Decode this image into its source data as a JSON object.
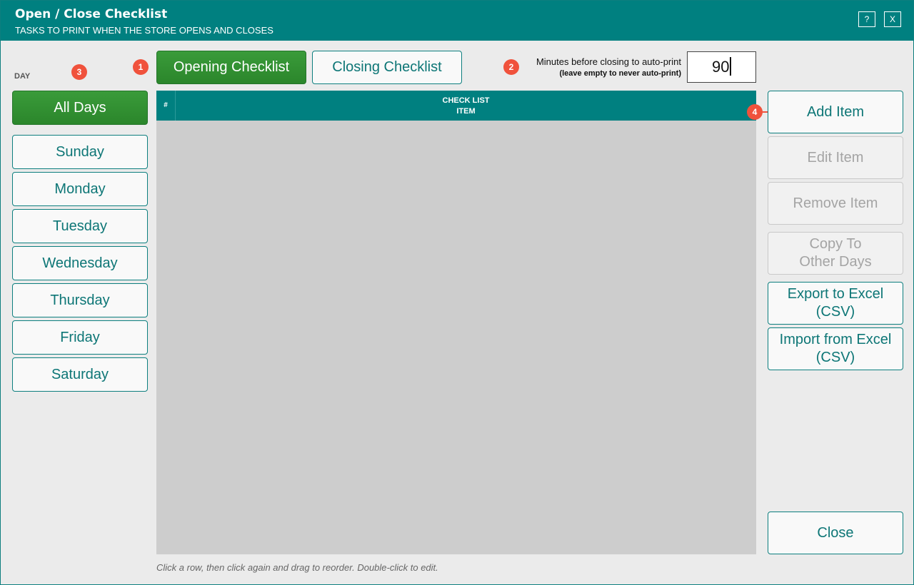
{
  "window": {
    "title": "Open / Close Checklist",
    "subtitle": "TASKS TO PRINT WHEN THE STORE OPENS AND CLOSES",
    "help_label": "?",
    "close_label": "X"
  },
  "days": {
    "label": "DAY",
    "items": [
      {
        "label": "All Days",
        "selected": true
      },
      {
        "label": "Sunday"
      },
      {
        "label": "Monday"
      },
      {
        "label": "Tuesday"
      },
      {
        "label": "Wednesday"
      },
      {
        "label": "Thursday"
      },
      {
        "label": "Friday"
      },
      {
        "label": "Saturday"
      }
    ]
  },
  "tabs": {
    "opening": "Opening Checklist",
    "closing": "Closing Checklist",
    "active": "opening"
  },
  "auto_print": {
    "label": "Minutes before closing to auto-print",
    "hint": "(leave empty to never auto-print)",
    "value": "90"
  },
  "table": {
    "columns": {
      "num": "#",
      "item_line1": "CHECK LIST",
      "item_line2": "ITEM"
    },
    "rows": []
  },
  "actions": {
    "add": "Add Item",
    "edit": "Edit Item",
    "remove": "Remove Item",
    "copy_line1": "Copy To",
    "copy_line2": "Other Days",
    "export_line1": "Export to Excel",
    "export_line2": "(CSV)",
    "import_line1": "Import from Excel",
    "import_line2": "(CSV)",
    "close": "Close"
  },
  "badges": {
    "b1": "1",
    "b2": "2",
    "b3": "3",
    "b4": "4"
  },
  "footer_hint": "Click a row, then click again and drag to reorder. Double-click to edit.",
  "colors": {
    "accent": "#008080",
    "selected": "#2f8f2f",
    "badge": "#f0523c",
    "disabled": "#a4a4a4"
  }
}
